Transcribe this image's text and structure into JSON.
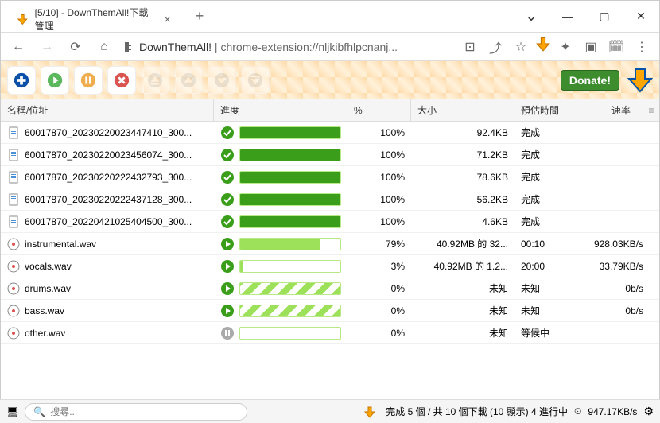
{
  "window": {
    "tab_title": "[5/10] - DownThemAll!下載管理",
    "url_app": "DownThemAll!",
    "url_path": "chrome-extension://nljkibfhlpcnanj..."
  },
  "toolbar": {
    "donate": "Donate!"
  },
  "columns": {
    "name": "名稱/位址",
    "progress": "進度",
    "percent": "%",
    "size": "大小",
    "eta": "預估時間",
    "speed": "速率"
  },
  "rows": [
    {
      "icon": "txt",
      "name": "60017870_20230220023447410_300...",
      "status": "done",
      "fill": 100,
      "fillstyle": "solid",
      "percent": "100%",
      "size": "92.4KB",
      "eta": "完成",
      "speed": ""
    },
    {
      "icon": "txt",
      "name": "60017870_20230220023456074_300...",
      "status": "done",
      "fill": 100,
      "fillstyle": "solid",
      "percent": "100%",
      "size": "71.2KB",
      "eta": "完成",
      "speed": ""
    },
    {
      "icon": "txt",
      "name": "60017870_20230220222432793_300...",
      "status": "done",
      "fill": 100,
      "fillstyle": "solid",
      "percent": "100%",
      "size": "78.6KB",
      "eta": "完成",
      "speed": ""
    },
    {
      "icon": "txt",
      "name": "60017870_20230220222437128_300...",
      "status": "done",
      "fill": 100,
      "fillstyle": "solid",
      "percent": "100%",
      "size": "56.2KB",
      "eta": "完成",
      "speed": ""
    },
    {
      "icon": "txt",
      "name": "60017870_20220421025404500_300...",
      "status": "done",
      "fill": 100,
      "fillstyle": "solid",
      "percent": "100%",
      "size": "4.6KB",
      "eta": "完成",
      "speed": ""
    },
    {
      "icon": "audio",
      "name": "instrumental.wav",
      "status": "play",
      "fill": 79,
      "fillstyle": "light",
      "percent": "79%",
      "size": "40.92MB 的 32...",
      "eta": "00:10",
      "speed": "928.03KB/s"
    },
    {
      "icon": "audio",
      "name": "vocals.wav",
      "status": "play",
      "fill": 3,
      "fillstyle": "light",
      "percent": "3%",
      "size": "40.92MB 的 1.2...",
      "eta": "20:00",
      "speed": "33.79KB/s"
    },
    {
      "icon": "audio",
      "name": "drums.wav",
      "status": "play",
      "fill": 100,
      "fillstyle": "stripe",
      "percent": "0%",
      "size": "未知",
      "eta": "未知",
      "speed": "0b/s"
    },
    {
      "icon": "audio",
      "name": "bass.wav",
      "status": "play",
      "fill": 100,
      "fillstyle": "stripe",
      "percent": "0%",
      "size": "未知",
      "eta": "未知",
      "speed": "0b/s"
    },
    {
      "icon": "audio",
      "name": "other.wav",
      "status": "pause",
      "fill": 0,
      "fillstyle": "empty",
      "percent": "0%",
      "size": "未知",
      "eta": "等候中",
      "speed": ""
    }
  ],
  "statusbar": {
    "search_placeholder": "搜尋...",
    "status": "完成 5 個 / 共 10 個下載 (10 顯示) 4 進行中",
    "speed": "947.17KB/s"
  }
}
